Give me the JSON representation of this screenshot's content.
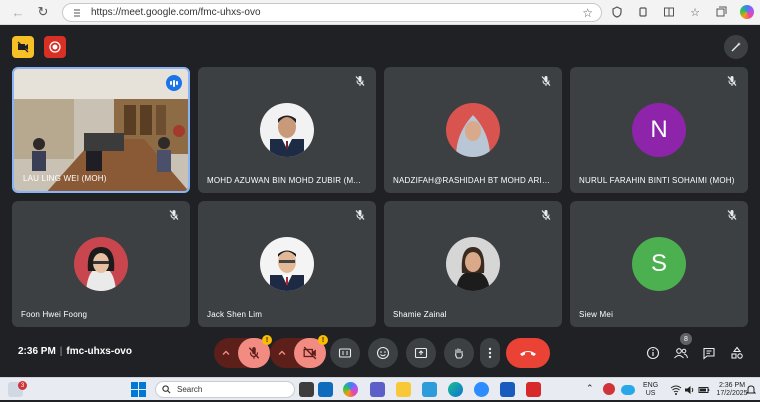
{
  "browser": {
    "url": "https://meet.google.com/fmc-uhxs-ovo"
  },
  "tiles": [
    {
      "name": "LAU LING WEI (MOH)",
      "type": "video"
    },
    {
      "name": "MOHD AZUWAN BIN MOHD ZUBIR (M...",
      "type": "photo"
    },
    {
      "name": "NADZIFAH@RASHIDAH BT MOHD ARIF...",
      "type": "photo"
    },
    {
      "name": "NURUL FARAHIN BINTI SOHAIMI (MOH)",
      "type": "letter",
      "letter": "N",
      "color": "#8e24aa"
    },
    {
      "name": "Foon Hwei Foong",
      "type": "photo"
    },
    {
      "name": "Jack Shen Lim",
      "type": "photo"
    },
    {
      "name": "Shamie Zainal",
      "type": "photo"
    },
    {
      "name": "Siew Mei",
      "type": "letter",
      "letter": "S",
      "color": "#4caf50"
    }
  ],
  "meeting": {
    "time": "2:36 PM",
    "code": "fmc-uhxs-ovo",
    "participants_count": "8"
  },
  "taskbar": {
    "search_label": "Search",
    "lang_top": "ENG",
    "lang_bottom": "US",
    "clock_time": "2:36 PM",
    "clock_date": "17/2/2025",
    "notif_count": "3"
  },
  "colors": {
    "accent": "#1a73e8",
    "hangup": "#ea4335",
    "mic_off": "#f28b82"
  }
}
